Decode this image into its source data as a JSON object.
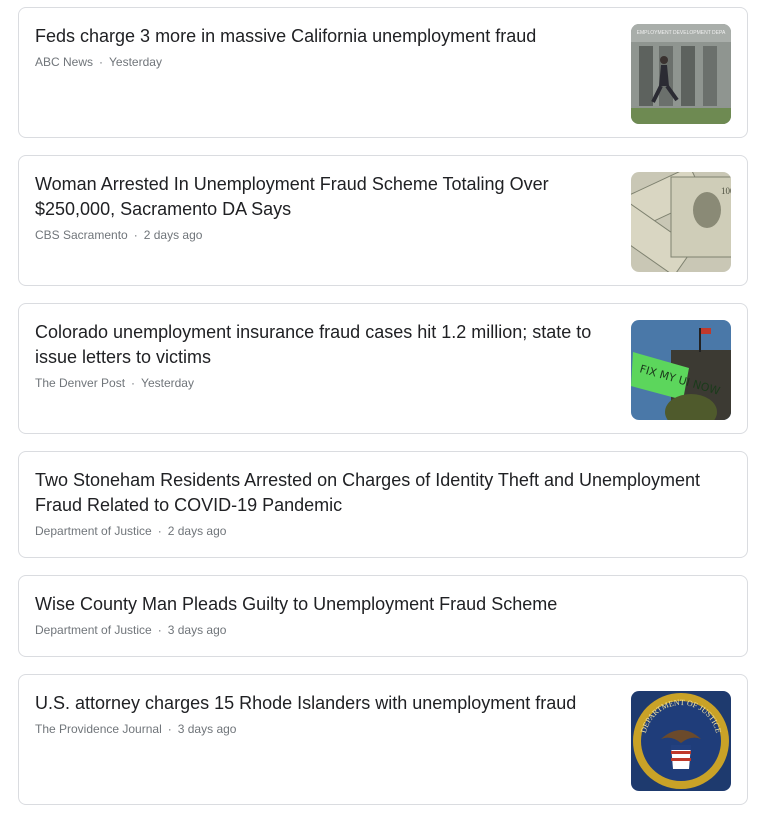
{
  "articles": [
    {
      "title": "Feds charge 3 more in massive California unemployment fraud",
      "source": "ABC News",
      "time": "Yesterday",
      "thumb_icon": "runner-building-photo",
      "thumb_text": "EMPLOYMENT DEVELOPMENT DEPA"
    },
    {
      "title": "Woman Arrested In Unemployment Fraud Scheme Totaling Over $250,000, Sacramento DA Says",
      "source": "CBS Sacramento",
      "time": "2 days ago",
      "thumb_icon": "dollar-bills-photo"
    },
    {
      "title": "Colorado unemployment insurance fraud cases hit 1.2 million; state to issue letters to victims",
      "source": "The Denver Post",
      "time": "Yesterday",
      "thumb_icon": "protest-sign-photo",
      "thumb_text": "FIX MY UI NOW"
    },
    {
      "title": "Two Stoneham Residents Arrested on Charges of Identity Theft and Unemployment Fraud Related to COVID-19 Pandemic",
      "source": "Department of Justice",
      "time": "2 days ago"
    },
    {
      "title": "Wise County Man Pleads Guilty to Unemployment Fraud Scheme",
      "source": "Department of Justice",
      "time": "3 days ago"
    },
    {
      "title": "U.S. attorney charges 15 Rhode Islanders with unemployment fraud",
      "source": "The Providence Journal",
      "time": "3 days ago",
      "thumb_icon": "doj-seal-photo",
      "thumb_text": "DEPARTMENT OF JUSTICE"
    }
  ],
  "separator": "·",
  "colors": {
    "border": "#dadce0",
    "title": "#202124",
    "meta": "#70757a"
  }
}
